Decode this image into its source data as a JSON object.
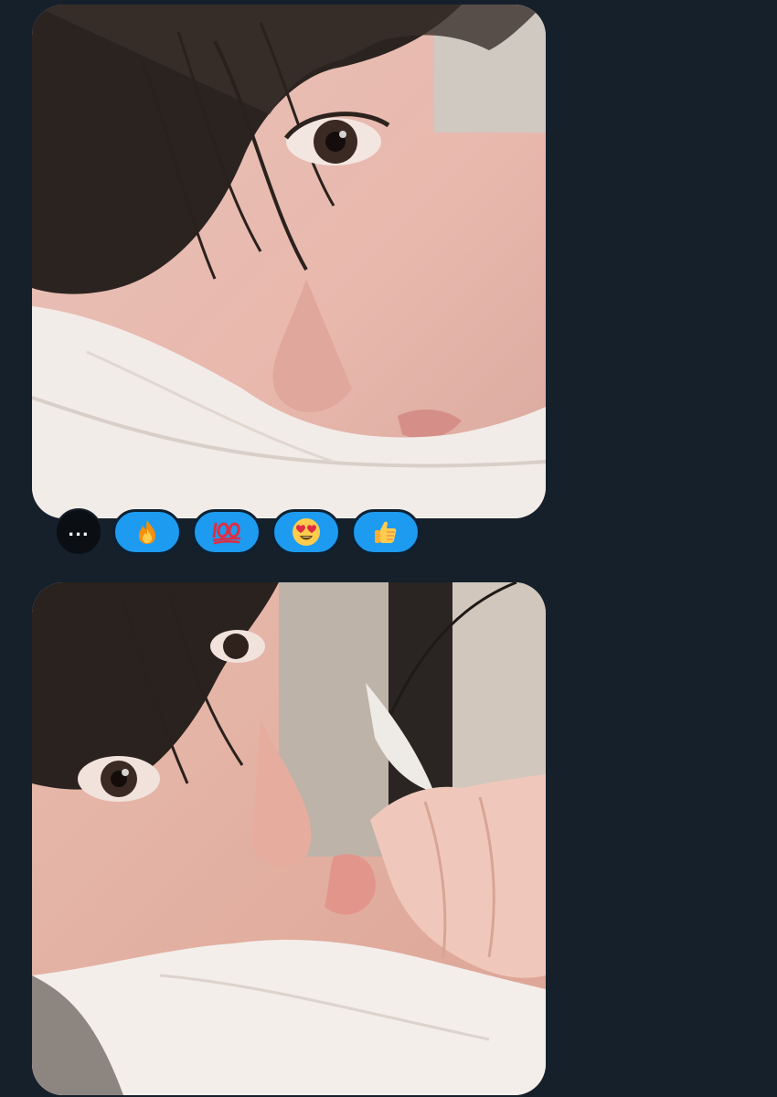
{
  "photos": [
    {
      "name": "photo-1",
      "icon": "photo-image"
    },
    {
      "name": "photo-2",
      "icon": "photo-image"
    }
  ],
  "reactions": {
    "more_label": "...",
    "items": [
      {
        "name": "fire",
        "icon": "fire-emoji-icon"
      },
      {
        "name": "hundred",
        "icon": "hundred-points-emoji-icon"
      },
      {
        "name": "heart-eyes",
        "icon": "heart-eyes-emoji-icon"
      },
      {
        "name": "thumbs-up",
        "icon": "thumbs-up-emoji-icon"
      }
    ]
  },
  "colors": {
    "background": "#15202b",
    "reaction_blue": "#1d9bf0",
    "more_button": "#0b0f14"
  }
}
